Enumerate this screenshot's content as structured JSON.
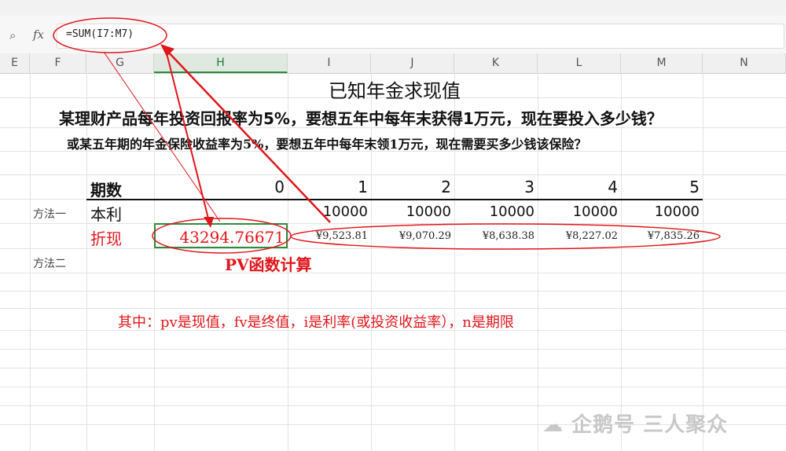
{
  "formula_bar": {
    "zoom_icon": "zoom-icon",
    "fx_label": "fx",
    "formula": "=SUM(I7:M7)"
  },
  "columns": [
    "E",
    "F",
    "G",
    "H",
    "I",
    "J",
    "K",
    "L",
    "M",
    "N"
  ],
  "selected_column": "H",
  "sheet": {
    "heading": "已知年金求现值",
    "question1": "某理财产品每年投资回报率为5%，要想五年中每年末获得1万元，现在要投入多少钱？",
    "question2": "或某五年期的年金保险收益率为5%，要想五年中每年末领1万元，现在需要买多少钱该保险？",
    "period_label": "期数",
    "periods": [
      "0",
      "1",
      "2",
      "3",
      "4",
      "5"
    ],
    "method1_label": "方法一",
    "principal_label": "本利",
    "principal_values": [
      "10000",
      "10000",
      "10000",
      "10000",
      "10000"
    ],
    "discount_label": "折现",
    "discount_sum": "43294.76671",
    "discount_values": [
      "¥9,523.81",
      "¥9,070.29",
      "¥8,638.38",
      "¥8,227.02",
      "¥7,835.26"
    ],
    "pv_note": "PV函数计算",
    "method2_label": "方法二",
    "explanation": "其中：pv是现值，fv是终值，i是利率(或投资收益率），n是期限"
  },
  "watermark": "企鹅号 三人聚众",
  "colors": {
    "annotation_red": "#e0161b",
    "selection_green": "#2e8b3e"
  }
}
